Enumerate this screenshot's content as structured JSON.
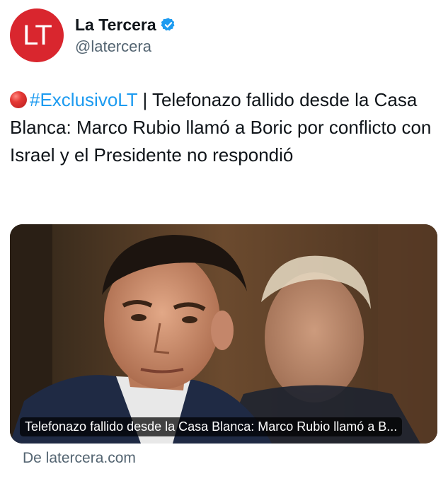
{
  "account": {
    "avatar_text": "LT",
    "display_name": "La Tercera",
    "handle": "@latercera",
    "verified": true,
    "avatar_color": "#d9262e"
  },
  "tweet": {
    "emoji": "red-circle",
    "hashtag": "#ExclusivoLT",
    "separator": " | ",
    "text": "Telefonazo fallido desde la Casa Blanca: Marco Rubio llamó a Boric por conflicto con Israel y el Presidente no respondió"
  },
  "link_card": {
    "image": "photo-two-men-in-suits",
    "caption": "Telefonazo fallido desde la Casa Blanca: Marco Rubio llamó a B...",
    "source": "De latercera.com"
  },
  "colors": {
    "hashtag": "#1d9bf0",
    "secondary_text": "#536471",
    "verified": "#1d9bf0"
  }
}
